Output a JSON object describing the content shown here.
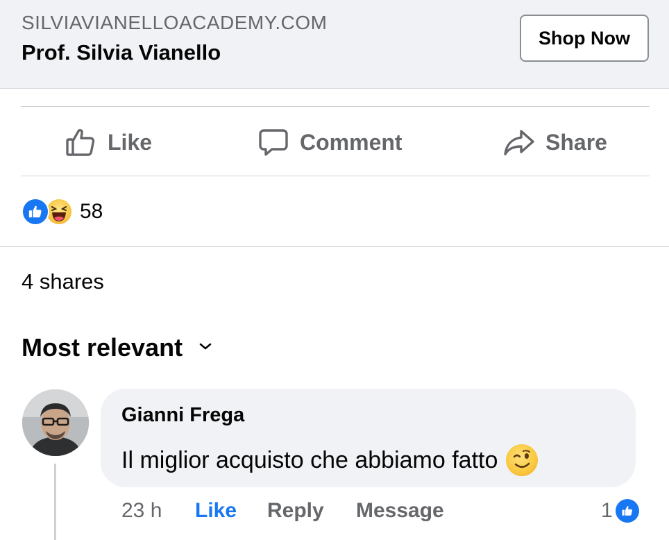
{
  "link_preview": {
    "domain": "SILVIAVIANELLOACADEMY.COM",
    "title": "Prof. Silvia Vianello",
    "cta_label": "Shop Now"
  },
  "actions": {
    "like_label": "Like",
    "comment_label": "Comment",
    "share_label": "Share"
  },
  "reactions": {
    "types": [
      "like-icon",
      "haha-icon"
    ],
    "count": "58"
  },
  "shares_text": "4 shares",
  "sort": {
    "label": "Most relevant",
    "icon": "chevron-down-icon"
  },
  "comment": {
    "author": "Gianni Frega",
    "text": "Il miglior acquisto che abbiamo fatto",
    "emoji": "wink-emoji",
    "time": "23 h",
    "like_label": "Like",
    "reply_label": "Reply",
    "message_label": "Message",
    "reaction_count": "1"
  },
  "colors": {
    "accent_blue": "#1877f2",
    "secondary_text": "#65676b",
    "card_background": "#f0f2f5"
  }
}
